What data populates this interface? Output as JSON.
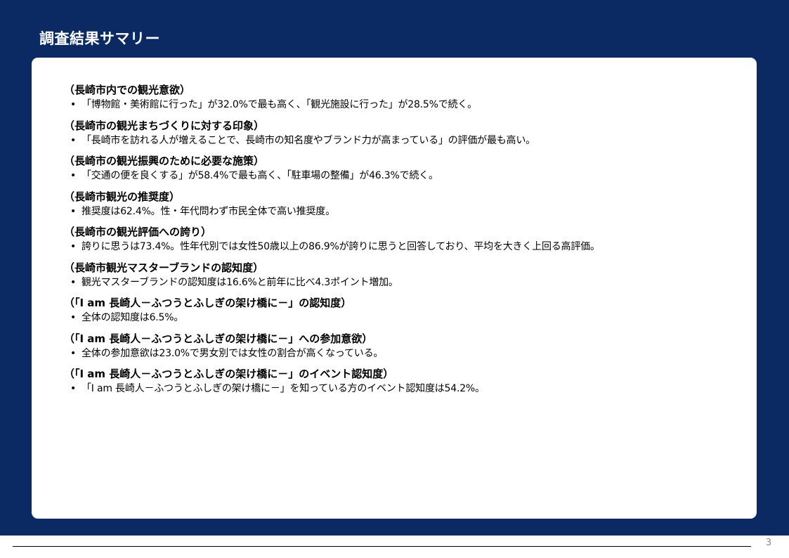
{
  "slide": {
    "title": "調査結果サマリー",
    "page_number": "3"
  },
  "sections": [
    {
      "heading": "（長崎市内での観光意欲）",
      "bullet": "「博物館・美術館に行った」が32.0%で最も高く、「観光施設に行った」が28.5%で続く。"
    },
    {
      "heading": "（長崎市の観光まちづくりに対する印象）",
      "bullet": "「長崎市を訪れる人が増えることで、長崎市の知名度やブランド力が高まっている」の評価が最も高い。"
    },
    {
      "heading": "（長崎市の観光振興のために必要な施策）",
      "bullet": "「交通の便を良くする」が58.4%で最も高く、「駐車場の整備」が46.3%で続く。"
    },
    {
      "heading": "（長崎市観光の推奨度）",
      "bullet": "推奨度は62.4%。性・年代問わず市民全体で高い推奨度。"
    },
    {
      "heading": "（長崎市の観光評価への誇り）",
      "bullet": "誇りに思うは73.4%。性年代別では女性50歳以上の86.9%が誇りに思うと回答しており、平均を大きく上回る高評価。"
    },
    {
      "heading": "（長崎市観光マスターブランドの認知度）",
      "bullet": "観光マスターブランドの認知度は16.6%と前年に比べ4.3ポイント増加。"
    },
    {
      "heading": "（「I am 長崎人－ふつうとふしぎの架け橋に－」の認知度）",
      "bullet": "全体の認知度は6.5%。"
    },
    {
      "heading": "（「I am 長崎人－ふつうとふしぎの架け橋に－」への参加意欲）",
      "bullet": "全体の参加意欲は23.0%で男女別では女性の割合が高くなっている。"
    },
    {
      "heading": "（「I am 長崎人－ふつうとふしぎの架け橋に－」のイベント認知度）",
      "bullet": "「I am 長崎人－ふつうとふしぎの架け橋に－」を知っている方のイベント認知度は54.2%。"
    }
  ],
  "bullet_symbol": "•",
  "colors": {
    "header_background": "#0b2a63",
    "panel_background": "#ffffff",
    "title_text": "#ffffff",
    "body_text": "#000000",
    "page_number": "#8a8a8a"
  }
}
